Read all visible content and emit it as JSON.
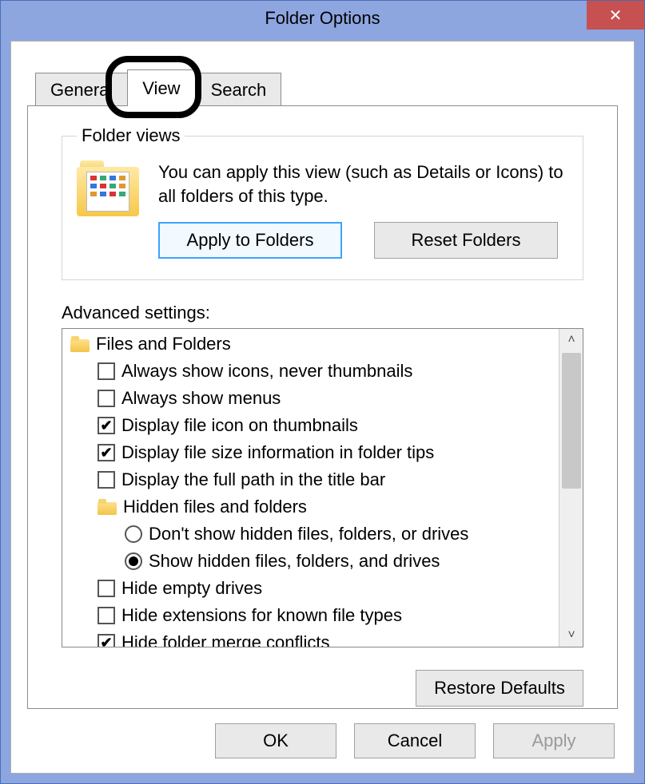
{
  "window": {
    "title": "Folder Options"
  },
  "tabs": {
    "general": "General",
    "view": "View",
    "search": "Search"
  },
  "folderViews": {
    "legend": "Folder views",
    "desc": "You can apply this view (such as Details or Icons) to all folders of this type.",
    "apply": "Apply to Folders",
    "reset": "Reset Folders"
  },
  "advanced": {
    "label": "Advanced settings:",
    "group": "Files and Folders",
    "opt_always_icons": "Always show icons, never thumbnails",
    "opt_always_menus": "Always show menus",
    "opt_file_icon_thumb": "Display file icon on thumbnails",
    "opt_file_size_tips": "Display file size information in folder tips",
    "opt_full_path_titlebar": "Display the full path in the title bar",
    "hidden_group": "Hidden files and folders",
    "opt_hidden_dont_show": "Don't show hidden files, folders, or drives",
    "opt_hidden_show": "Show hidden files, folders, and drives",
    "opt_hide_empty": "Hide empty drives",
    "opt_hide_ext": "Hide extensions for known file types",
    "opt_hide_merge": "Hide folder merge conflicts"
  },
  "restore": "Restore Defaults",
  "buttons": {
    "ok": "OK",
    "cancel": "Cancel",
    "apply": "Apply"
  }
}
